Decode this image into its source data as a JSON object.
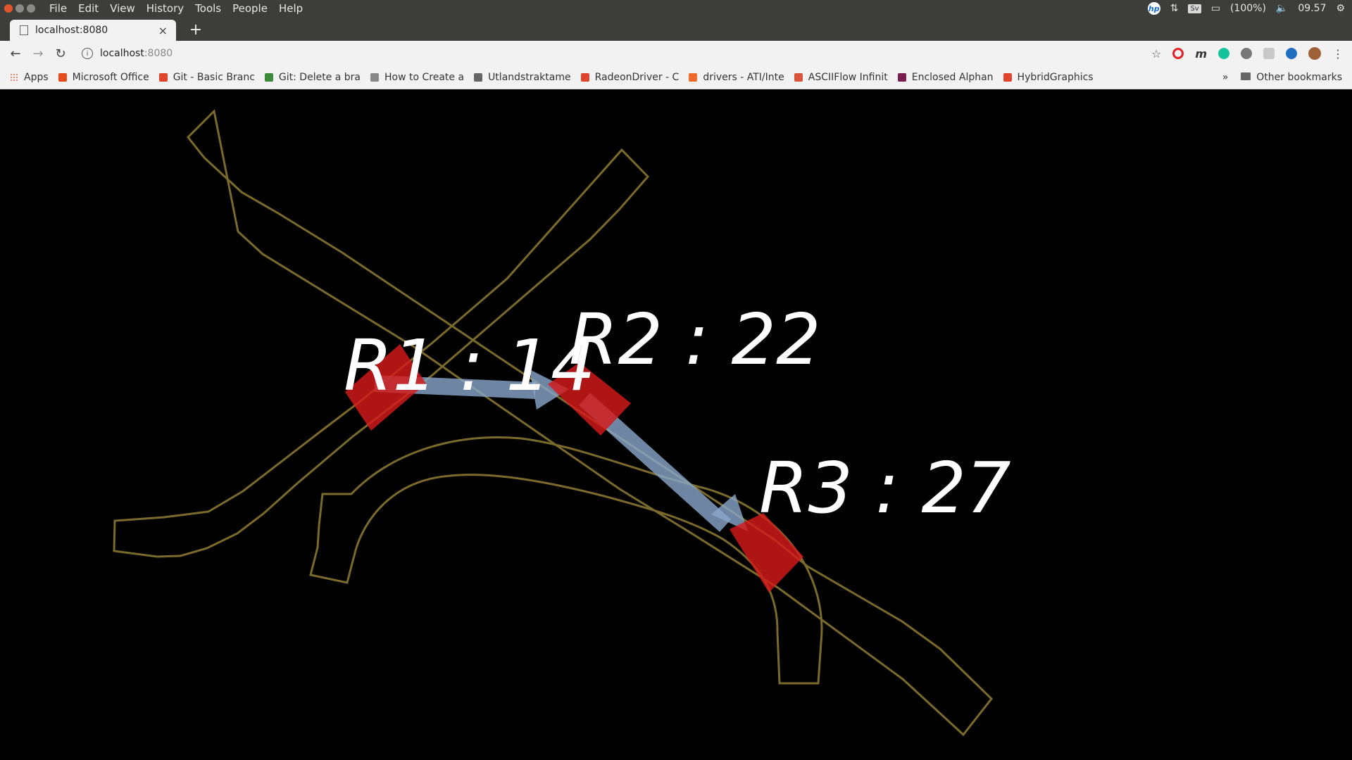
{
  "menubar": {
    "items": [
      "File",
      "Edit",
      "View",
      "History",
      "Tools",
      "People",
      "Help"
    ],
    "tray": {
      "hp": "hp",
      "keyboard": "Sv",
      "battery": "(100%)",
      "clock": "09.57"
    }
  },
  "tab": {
    "title": "localhost:8080"
  },
  "address": {
    "host": "localhost",
    "port": ":8080"
  },
  "bookmarks": [
    {
      "label": "Apps",
      "color": "#e64a19"
    },
    {
      "label": "Microsoft Office",
      "color": "#e64a19"
    },
    {
      "label": "Git - Basic Branc",
      "color": "#e0442d"
    },
    {
      "label": "Git: Delete a bra",
      "color": "#3c8a3c"
    },
    {
      "label": "How to Create a",
      "color": "#888888"
    },
    {
      "label": "Utlandstraktame",
      "color": "#666666"
    },
    {
      "label": "RadeonDriver - C",
      "color": "#e0442d"
    },
    {
      "label": "drivers - ATI/Inte",
      "color": "#f06a2a"
    },
    {
      "label": "ASCIIFlow Infinit",
      "color": "#d8543a"
    },
    {
      "label": "Enclosed Alphan",
      "color": "#7a1d4e"
    },
    {
      "label": "HybridGraphics",
      "color": "#e0442d"
    }
  ],
  "bookmarks_more": "»",
  "other_bookmarks": "Other bookmarks",
  "scene": {
    "labels": [
      {
        "id": "r1",
        "text": "R1 : 14"
      },
      {
        "id": "r2",
        "text": "R2 : 22"
      },
      {
        "id": "r3",
        "text": "R3 : 27"
      }
    ],
    "colors": {
      "road": "#7a6a2c",
      "marker": "#d61a1a",
      "arrow": "#8aa8cc"
    }
  }
}
